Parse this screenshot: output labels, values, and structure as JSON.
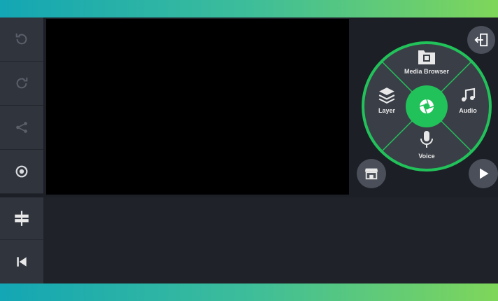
{
  "toolbar": {
    "items": [
      {
        "icon": "undo-icon"
      },
      {
        "icon": "redo-icon"
      },
      {
        "icon": "share-icon"
      },
      {
        "icon": "settings-icon"
      },
      {
        "icon": "timeline-adjust-icon"
      },
      {
        "icon": "skip-to-start-icon"
      }
    ]
  },
  "wheel": {
    "center_icon": "camera-shutter-icon",
    "items": {
      "media": {
        "label": "Media Browser",
        "icon": "media-browser-icon"
      },
      "layer": {
        "label": "Layer",
        "icon": "layer-icon"
      },
      "audio": {
        "label": "Audio",
        "icon": "music-note-icon"
      },
      "voice": {
        "label": "Voice",
        "icon": "microphone-icon"
      }
    }
  },
  "buttons": {
    "exit": {
      "icon": "exit-icon"
    },
    "store": {
      "icon": "store-icon"
    },
    "play": {
      "icon": "play-icon"
    }
  },
  "colors": {
    "accent": "#22c25a",
    "toolbar_bg": "#30343d",
    "app_bg": "#1c1f26",
    "wheel_bg": "#3a3e47"
  }
}
